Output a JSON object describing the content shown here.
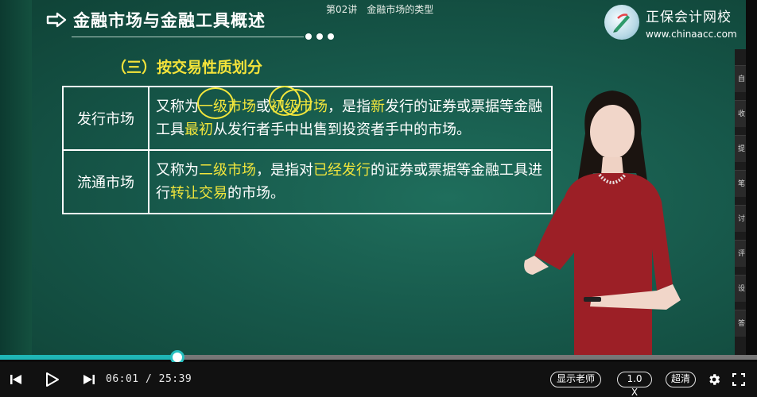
{
  "slide": {
    "title": "金融市场与金融工具概述",
    "lecture_number": "第02讲",
    "lecture_topic": "金融市场的类型",
    "section_heading": "（三）按交易性质划分",
    "rows": [
      {
        "term": "发行市场",
        "segments": [
          {
            "text": "又称为",
            "hl": false
          },
          {
            "text": "一级市场",
            "hl": true
          },
          {
            "text": "或",
            "hl": false
          },
          {
            "text": "初级市场",
            "hl": true
          },
          {
            "text": "，是指",
            "hl": false
          },
          {
            "text": "新",
            "hl": true
          },
          {
            "text": "发行的证券或票据等金融工具",
            "hl": false
          },
          {
            "text": "最初",
            "hl": true
          },
          {
            "text": "从发行者手中出售到投资者手中的市场。",
            "hl": false
          }
        ]
      },
      {
        "term": "流通市场",
        "segments": [
          {
            "text": "又称为",
            "hl": false
          },
          {
            "text": "二级市场",
            "hl": true
          },
          {
            "text": "，是指对",
            "hl": false
          },
          {
            "text": "已经发行",
            "hl": true
          },
          {
            "text": "的证券或票据等金融工具进行",
            "hl": false
          },
          {
            "text": "转让交易",
            "hl": true
          },
          {
            "text": "的市场。",
            "hl": false
          }
        ]
      }
    ]
  },
  "logo": {
    "name": "正保会计网校",
    "url": "www.chinaacc.com"
  },
  "player": {
    "current_time": "06:01",
    "time_separator": "/",
    "duration": "25:39",
    "progress": 0.2345,
    "show_teacher_label": "显示老师",
    "speed_label": "1.0 X",
    "quality_label": "超清"
  },
  "side_panel_chips": [
    "自",
    "收",
    "提",
    "笔",
    "讨",
    "评",
    "设",
    "答"
  ],
  "colors": {
    "highlight": "#f2e63c",
    "progress": "#1fb6b6",
    "board": "#17594b"
  }
}
